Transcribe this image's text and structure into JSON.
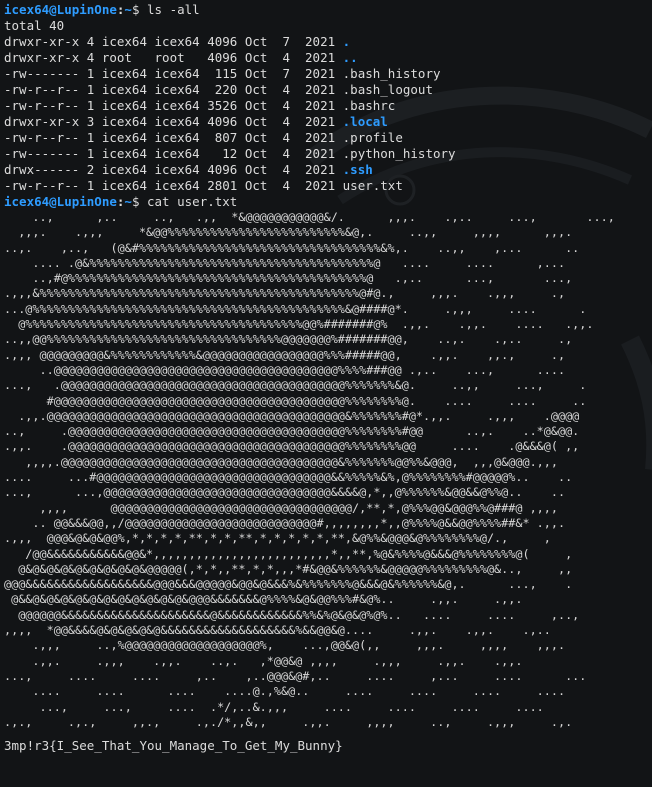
{
  "prompt1": {
    "user": "icex64@LupinOne",
    "sep": ":",
    "path": "~",
    "dollar": "$",
    "cmd": " ls -all"
  },
  "total": "total 40",
  "listing": [
    {
      "perm": "drwxr-xr-x 4 icex64 icex64 4096 Oct  7  2021 ",
      "name": ".",
      "dir": true
    },
    {
      "perm": "drwxr-xr-x 4 root   root   4096 Oct  4  2021 ",
      "name": "..",
      "dir": true
    },
    {
      "perm": "-rw------- 1 icex64 icex64  115 Oct  7  2021 ",
      "name": ".bash_history",
      "dir": false
    },
    {
      "perm": "-rw-r--r-- 1 icex64 icex64  220 Oct  4  2021 ",
      "name": ".bash_logout",
      "dir": false
    },
    {
      "perm": "-rw-r--r-- 1 icex64 icex64 3526 Oct  4  2021 ",
      "name": ".bashrc",
      "dir": false
    },
    {
      "perm": "drwxr-xr-x 3 icex64 icex64 4096 Oct  4  2021 ",
      "name": ".local",
      "dir": true
    },
    {
      "perm": "-rw-r--r-- 1 icex64 icex64  807 Oct  4  2021 ",
      "name": ".profile",
      "dir": false
    },
    {
      "perm": "-rw------- 1 icex64 icex64   12 Oct  4  2021 ",
      "name": ".python_history",
      "dir": false
    },
    {
      "perm": "drwx------ 2 icex64 icex64 4096 Oct  4  2021 ",
      "name": ".ssh",
      "dir": true
    },
    {
      "perm": "-rw-r--r-- 1 icex64 icex64 2801 Oct  4  2021 ",
      "name": "user.txt",
      "dir": false
    }
  ],
  "prompt2": {
    "user": "icex64@LupinOne",
    "sep": ":",
    "path": "~",
    "dollar": "$",
    "cmd": " cat user.txt"
  },
  "art": [
    "    ..,      ,..     ..,   .,,  *&@@@@@@@@@@@&/.      ,,,.    .,..     ...,       ...,",
    "  ,,,.    .,,,     *&@@%%%%%%%%%%%%%%%%%%%%%%%%%&@,.     ..,,     ,,,,      ,,,.",
    "..,.    ,..,   (@&#%%%%%%%%%%%%%%%%%%%%%%%%%%%%%%%%%%&%,.    ..,,    ,...      ..",
    "    .... .@&%%%%%%%%%%%%%%%%%%%%%%%%%%%%%%%%%%%%%%%%@   ....     ....      ,...",
    "    ..,#@%%%%%%%%%%%%%%%%%%%%%%%%%%%%%%%%%%%%%%%%%%@   .,..      ...,       ...,",
    ".,,,&%%%%%%%%%%%%%%%%%%%%%%%%%%%%%%%%%%%%%%%%%%%%%@#@.,     ,,,.    .,,,     .,",
    "...@%%%%%%%%%%%%%%%%%%%%%%%%%%%%%%%%%%%%%%%%%%%%&@####@*.     .,,,     ....      .",
    "  @%%%%%%%%%%%%%%%%%%%%%%%%%%%%%%%%%%%%%%%@@%#######@%  .,,.    .,,.    ....   .,,.",
    "..,,@@%%%%%%%%%%%%%%%%%%%%%%%%%%%%%%%%%@@@@@@@%#######@@,    ..,.    .,..     .,",
    ".,,, @@@@@@@@@&%%%%%%%%%%%%&@@@@@@@@@@@@@@@@@%%%#####@@,    .,,.    ,,.,     .,",
    "     ..@@@@@@@@@@@@@@@@@@@@@@@@@@@@@@@@@@@@@@@@%%%%###@@ .,..    ...,      ....",
    "...,   .@@@@@@@@@@@@@@@@@@@@@@@@@@@@@@@@@@@@@@@@%%%%%%%&@.     ..,,     ...,     .",
    "      #@@@@@@@@@@@@@@@@@@@@@@@@@@@@@@@@@@@@@@@@@%%%%%%%%@.    ....     ....     ..",
    "  .,,.@@@@@@@@@@@@@@@@@@@@@@@@@@@@@@@@@@@@@@@@@@&%%%%%%%#@*.,,.     .,,,    .@@@@",
    "..,     .@@@@@@@@@@@@@@@@@@@@@@@@@@@@@@@@@@@@@@@%%%%%%%%#@@      ..,.    ..*@&@@.",
    ".,,.    .@@@@@@@@@@@@@@@@@@@@@@@@@@@@@@@@@@@@@@@%%%%%%%%@@     ....    .@&&&@( ,,",
    "   ,,,,.@@@@@@@@@@@@@@@@@@@@@@@@@@@@@@@@@@@@@@@&%%%%%%%@@%%&@@@,  ,,,@&@@@.,,,",
    "....     ...#@@@@@@@@@@@@@@@@@@@@@@@@@@@@@@@@@&&%%%%%&%,@%%%%%%%%#@@@@@%..    ..",
    "...,      ...,@@@@@@@@@@@@@@@@@@@@@@@@@@@@@@@@&&&&@,*,,@%%%%%%&@@&&@%%@..    ..",
    "     ,,,,      @@@@@@@@@@@@@@@@@@@@@@@@@@@@@@@@@@/,**,*,@%%%@@&@@@%%@###@ ,,,,",
    "    .. @@&&&@@,,/@@@@@@@@@@@@@@@@@@@@@@@@@@@#,,,,,,,,*,,@%%%%@&&@@%%%%##&* .,,.",
    ".,,,  @@@&@&@&@@%,*,*,*,*,**,*,*,**,*,*,*,*,*,**,&@%%&@@@&@%%%%%%%%@/.,     ,",
    "   /@@&&&&&&&&&&&@@&*,,,,,,,,,,,,,,,,,,,,,,,,,*,,**,%@&%%%%@&&&@%%%%%%%%@(     ,",
    "  @&@&@&@&@&@&@&@&@&@@@@@(,*,*,,**,*,*,,,*#&@@&%%%%%%&@@@@@%%%%%%%%%@&..,     ,,",
    "@@@&&&&&&&&&&&&&&&&&&@@@&&&@@@@@&@@&@&&&%&%%%%%%%@&&&@&%%%%%%&@,.      ...,    .",
    " @&&@&@&@&@&@&@&@&@&@&@&@&@@@&&&&&&&@%%%%&@&@@%%%#&@%..     .,,.     .,,.",
    "  @@@@@@&&&&&&&&&&&&&&&&&&&&&@&&&&&&&&&&&&%%&%@&@&@%@%..   ....     ....     ,..,",
    ",,,,  *@@&&&&@&@&@&@&@&&&&&&&&&&&&&&&&&&&%&&@@&@....     .,,.    .,,.    .,..",
    "    .,,,     ..,%@@@@@@@@@@@@@@@@@@@%,    ...,@@&@(,,     ,,,.     ,,,,    ,,,.",
    "    .,,.     .,,,    .,,.    ..,.   ,*@@&@ ,,,,     .,,,     .,,.    .,,.",
    "...,     ....     ....     ,..    ,..@@@&@#,..     ....     ,...     ....      ...",
    "    ....     ....      ....    ....@.,%&@..     ....     ....     ....     ....",
    "     ...,     ...,     ....  .*/,..&.,,,     ....     ....     ....     ....",
    ".,.,     .,.,     ,,.,     .,./*,,&,,     .,,.     ,,,,     ..,     .,,,     .,."
  ],
  "flag": "3mp!r3{I_See_That_You_Manage_To_Get_My_Bunny}"
}
